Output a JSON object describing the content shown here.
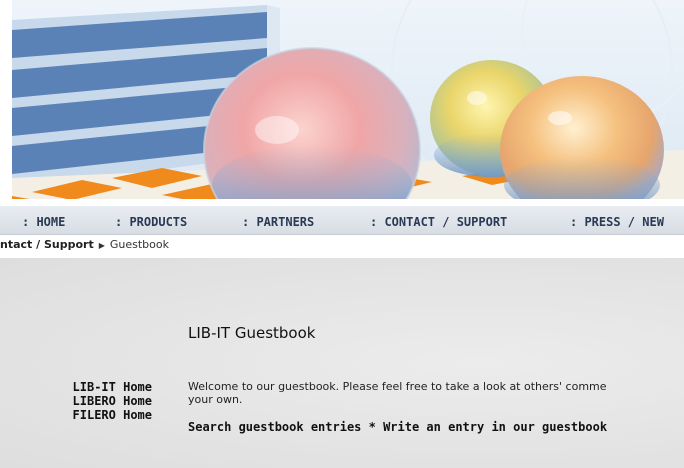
{
  "nav": {
    "items": [
      {
        "label": ": HOME"
      },
      {
        "label": ": PRODUCTS"
      },
      {
        "label": ": PARTNERS"
      },
      {
        "label": ": CONTACT / SUPPORT"
      },
      {
        "label": ": PRESS / NEW"
      }
    ]
  },
  "breadcrumb": {
    "parent": "ntact / Support",
    "current": "Guestbook"
  },
  "main": {
    "title": "LIB-IT Guestbook",
    "side_links": [
      "LIB-IT Home",
      "LIBERO Home",
      "FILERO Home"
    ],
    "intro_line1": "Welcome to our guestbook. Please feel free to take a look at others' comme",
    "intro_line2": "your own.",
    "search_link": "Search guestbook entries",
    "separator": " * ",
    "write_link": "Write an entry in our guestbook"
  },
  "colors": {
    "nav_text": "#2a3a55",
    "content_bg": "#e2e2e2",
    "text": "#111111"
  }
}
